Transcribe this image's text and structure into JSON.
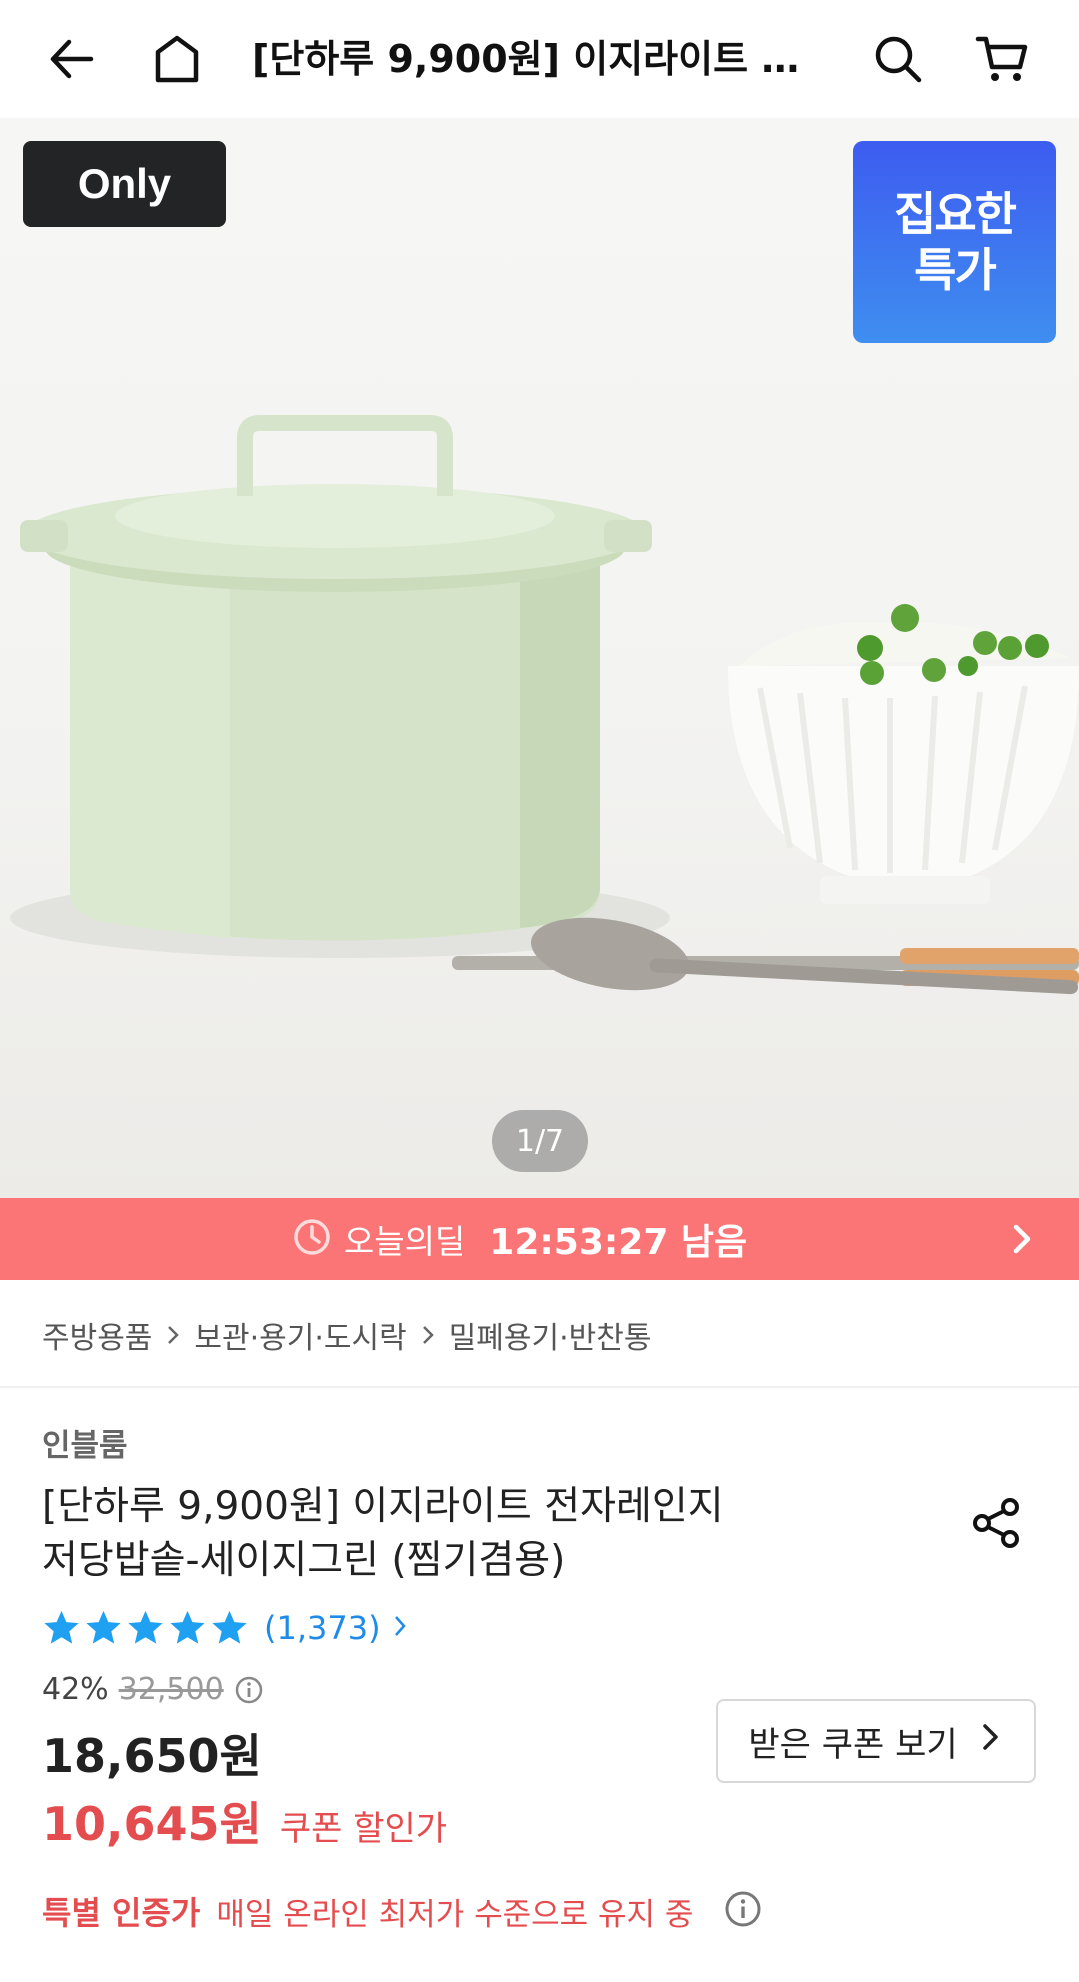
{
  "topbar": {
    "title": "[단하루 9,900원] 이지라이트 전자레인지 저당밥솥-세이지그린 (찜기겸용)",
    "icons": [
      "back-arrow-icon",
      "home-icon",
      "search-icon",
      "cart-icon"
    ]
  },
  "hero": {
    "only_badge": "Only",
    "special_badge_line1": "집요한",
    "special_badge_line2": "특가",
    "counter": "1/7"
  },
  "deal": {
    "label": "오늘의딜",
    "time": "12:53:27 남음",
    "color": "#fb7576"
  },
  "breadcrumb": {
    "items": [
      "주방용품",
      "보관·용기·도시락",
      "밀폐용기·반찬통"
    ]
  },
  "product": {
    "brand": "인블룸",
    "title_line1": "[단하루 9,900원] 이지라이트 전자레인지",
    "title_line2": "저당밥솥-세이지그린 (찜기겸용)",
    "rating_stars": 5,
    "rating_count": "(1,373)",
    "discount_pct": "42%",
    "original_price": "32,500",
    "price": "18,650원",
    "coupon_price": "10,645원",
    "coupon_price_label": "쿠폰 할인가",
    "coupon_button": "받은 쿠폰 보기",
    "cert_title": "특별 인증가",
    "cert_desc": "매일 온라인 최저가 수준으로 유지 중"
  },
  "colors": {
    "accent_red": "#e44d4f",
    "rating_blue": "#1f8be8",
    "badge_blue": "#3d5cf0"
  }
}
